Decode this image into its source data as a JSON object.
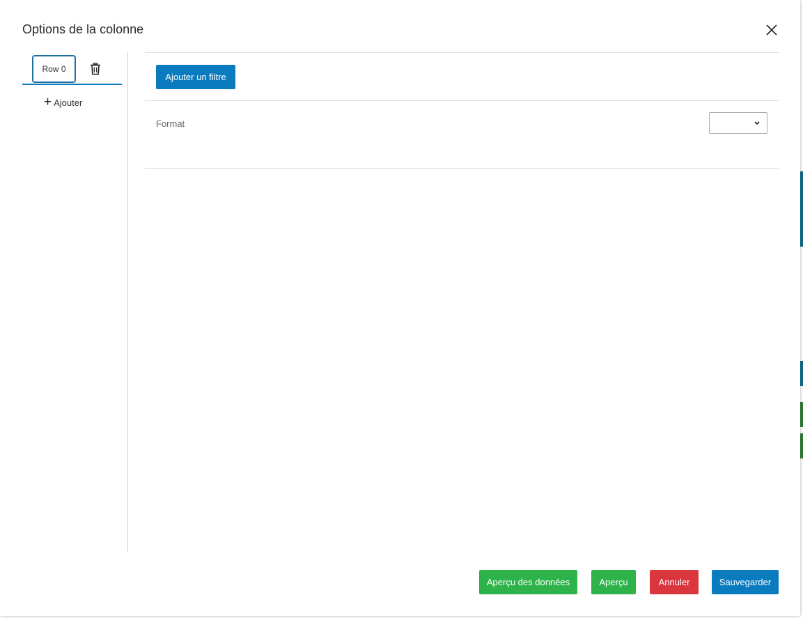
{
  "modal": {
    "title": "Options de la colonne"
  },
  "rows": {
    "tabs": [
      {
        "label": "Row 0"
      }
    ],
    "add_label": "Ajouter"
  },
  "content": {
    "add_filter_label": "Ajouter un filtre",
    "format_label": "Format",
    "format_value": ""
  },
  "footer": {
    "data_preview_label": "Aperçu des données",
    "preview_label": "Aperçu",
    "cancel_label": "Annuler",
    "save_label": "Sauvegarder"
  },
  "colors": {
    "primary": "#0b7bbf",
    "success": "#2db34a",
    "danger": "#d9363e"
  },
  "icons": [
    "close-icon",
    "trash-icon",
    "plus-icon",
    "chevron-down-icon"
  ]
}
